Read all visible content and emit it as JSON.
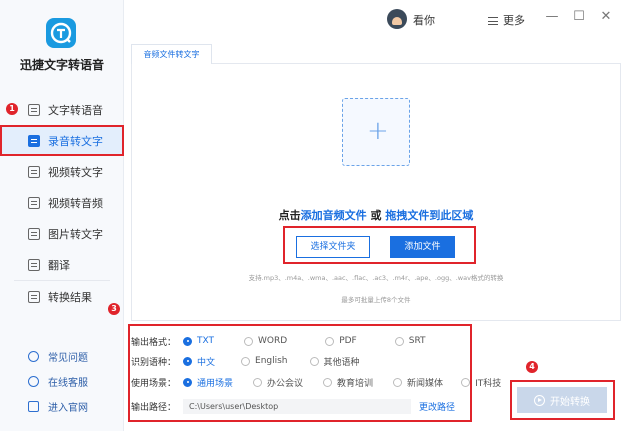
{
  "app": {
    "title": "迅捷文字转语音"
  },
  "colors": {
    "accent": "#1a6fe0",
    "highlight_box": "#e0242b",
    "logo": "#1a9ae0"
  },
  "titlebar": {
    "username": "看你",
    "more_label": "更多",
    "minimize": "—",
    "maximize": "☐",
    "close": "✕"
  },
  "sidebar": {
    "items": [
      {
        "label": "文字转语音",
        "icon": "doc-audio-icon"
      },
      {
        "label": "录音转文字",
        "icon": "record-text-icon",
        "active": true
      },
      {
        "label": "视频转文字",
        "icon": "video-text-icon"
      },
      {
        "label": "视频转音频",
        "icon": "video-audio-icon"
      },
      {
        "label": "图片转文字",
        "icon": "image-text-icon"
      },
      {
        "label": "翻译",
        "icon": "translate-icon"
      },
      {
        "label": "转换结果",
        "icon": "result-icon"
      }
    ],
    "links": [
      {
        "label": "常见问题",
        "icon": "question-icon"
      },
      {
        "label": "在线客服",
        "icon": "headset-icon"
      },
      {
        "label": "进入官网",
        "icon": "monitor-icon"
      }
    ]
  },
  "badges": [
    "1",
    "2",
    "3",
    "4"
  ],
  "main": {
    "tab_label": "音频文件转文字",
    "drop_prefix": "点击",
    "drop_link1": "添加音频文件",
    "drop_or": " 或 ",
    "drop_link2": "拖拽文件到此区域",
    "btn_select_folder": "选择文件夹",
    "btn_add_file": "添加文件",
    "support_text": "支持.mp3、.m4a、.wma、.aac、.flac、.ac3、.m4r、.ape、.ogg、.wav格式的转换",
    "limit_text": "最多可批量上传8个文件"
  },
  "options": {
    "format_label": "输出格式：",
    "formats": [
      "TXT",
      "WORD",
      "PDF",
      "SRT"
    ],
    "lang_label": "识别语种：",
    "langs": [
      "中文",
      "English",
      "其他语种"
    ],
    "scene_label": "使用场景：",
    "scenes": [
      "通用场景",
      "办公会议",
      "教育培训",
      "新闻媒体",
      "IT科技"
    ],
    "path_label": "输出路径：",
    "path_value": "C:\\Users\\user\\Desktop",
    "change_path": "更改路径"
  },
  "start_button": "开始转换"
}
